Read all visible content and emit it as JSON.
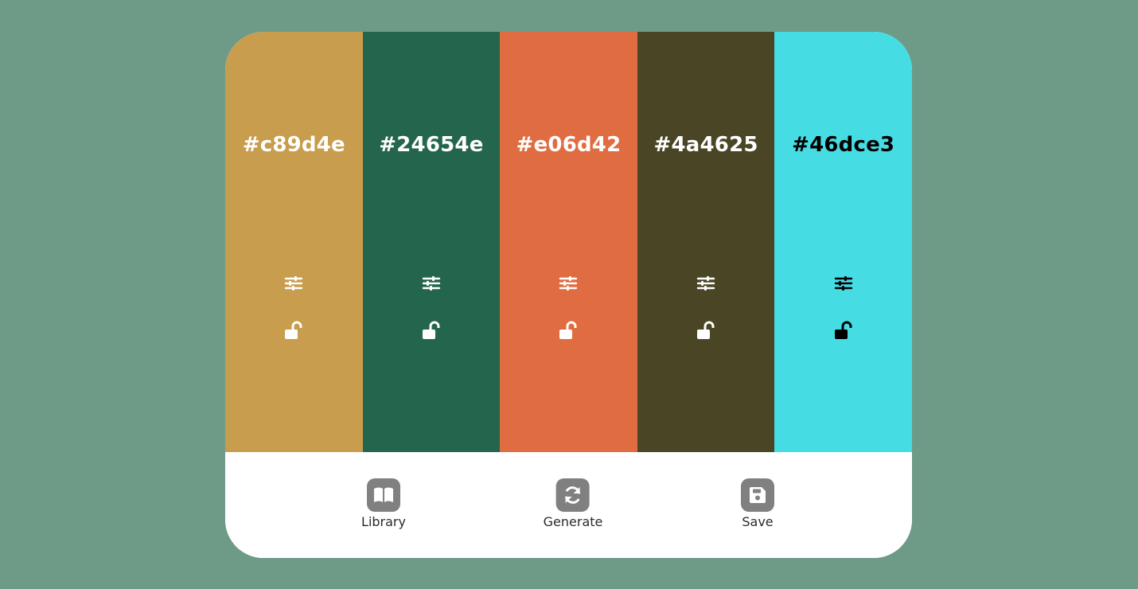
{
  "palette": {
    "swatches": [
      {
        "hex": "#c89d4e",
        "text_color": "#ffffff"
      },
      {
        "hex": "#24654e",
        "text_color": "#ffffff"
      },
      {
        "hex": "#e06d42",
        "text_color": "#ffffff"
      },
      {
        "hex": "#4a4625",
        "text_color": "#ffffff"
      },
      {
        "hex": "#46dce3",
        "text_color": "#000000"
      }
    ],
    "swatch_icons": [
      "sliders-icon",
      "unlock-icon"
    ]
  },
  "toolbar": {
    "library_label": "Library",
    "library_icon": "book-open-icon",
    "generate_label": "Generate",
    "generate_icon": "refresh-icon",
    "save_label": "Save",
    "save_icon": "floppy-disk-icon",
    "icon_bg": "#808080"
  },
  "colors": {
    "page_background": "#6e9a88",
    "card_background": "#ffffff"
  }
}
